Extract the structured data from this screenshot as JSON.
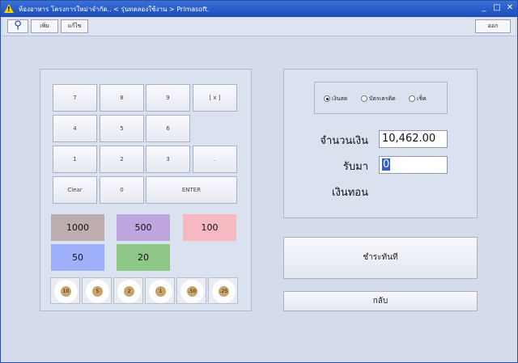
{
  "window": {
    "title": "ห้องอาหาร โครงการใหม่าจำกัด.. < รุ่นทดลองใช้งาน > Primasoft.",
    "warn_glyph": "!",
    "minimize_glyph": "_",
    "maximize_glyph": "□",
    "close_glyph": "✕"
  },
  "toolbar": {
    "search_glyph": "⚲",
    "add_label": "เพิ่ม",
    "edit_label": "แก้ไข",
    "exit_label": "ออก"
  },
  "keypad": {
    "k7": "7",
    "k8": "8",
    "k9": "9",
    "kx": "[ x ]",
    "k4": "4",
    "k5": "5",
    "k6": "6",
    "k1": "1",
    "k2": "2",
    "k3": "3",
    "kdot": ".",
    "clear": "Clear",
    "k0": "0",
    "enter": "ENTER"
  },
  "banknotes": [
    {
      "label": "1000",
      "color": "#bdadae"
    },
    {
      "label": "500",
      "color": "#c0a6df"
    },
    {
      "label": "100",
      "color": "#f6b9c1"
    },
    {
      "label": "50",
      "color": "#9fb0fb"
    },
    {
      "label": "20",
      "color": "#8ec688"
    }
  ],
  "coins": [
    "10",
    "5",
    "2",
    "1",
    ".50",
    ".25"
  ],
  "payment": {
    "methods": [
      "เงินสด",
      "บัตรเครดิต",
      "เช็ค"
    ],
    "selected": "เงินสด",
    "amount_label": "จำนวนเงิน",
    "amount_value": "10,462.00",
    "received_label": "รับมา",
    "received_value": "0",
    "change_label": "เงินทอน",
    "pay_button": "ชำระทันที",
    "back_button": "กลับ"
  }
}
